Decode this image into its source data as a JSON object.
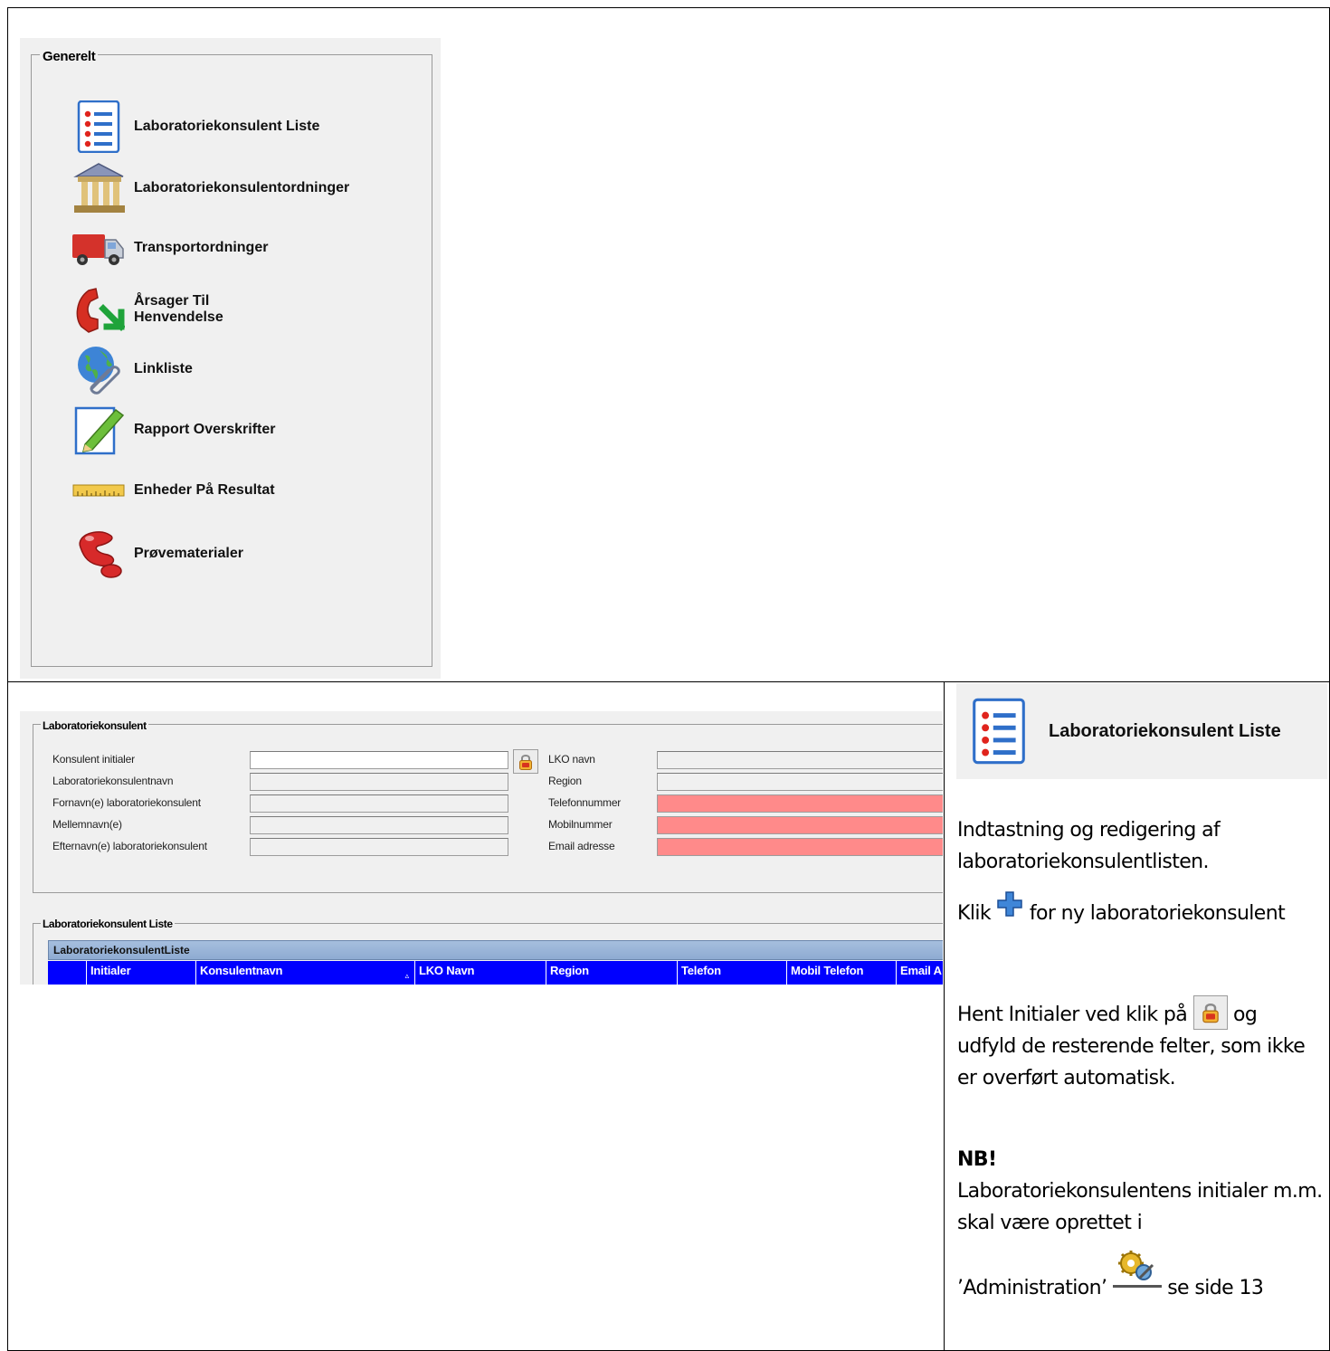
{
  "generelt": {
    "title": "Generelt",
    "items": [
      {
        "label": "Laboratoriekonsulent Liste",
        "icon": "list-icon"
      },
      {
        "label": "Laboratoriekonsulentordninger",
        "icon": "building-icon"
      },
      {
        "label": "Transportordninger",
        "icon": "truck-icon"
      },
      {
        "label": "Årsager Til\nHenvendelse",
        "icon": "phone-icon"
      },
      {
        "label": "Linkliste",
        "icon": "globe-link-icon"
      },
      {
        "label": "Rapport Overskrifter",
        "icon": "edit-pencil-icon"
      },
      {
        "label": "Enheder På Resultat",
        "icon": "ruler-icon"
      },
      {
        "label": "Prøvematerialer",
        "icon": "sample-blob-icon"
      }
    ]
  },
  "form": {
    "title": "Laboratoriekonsulent",
    "fields_left": [
      {
        "label": "Konsulent initialer",
        "value": ""
      },
      {
        "label": "Laboratoriekonsulentnavn",
        "value": ""
      },
      {
        "label": "Fornavn(e) laboratoriekonsulent",
        "value": ""
      },
      {
        "label": "Mellemnavn(e)",
        "value": ""
      },
      {
        "label": "Efternavn(e) laboratoriekonsulent",
        "value": ""
      }
    ],
    "fields_right": [
      {
        "label": "LKO navn",
        "value": ""
      },
      {
        "label": "Region",
        "value": ""
      },
      {
        "label": "Telefonnummer",
        "value": ""
      },
      {
        "label": "Mobilnummer",
        "value": ""
      },
      {
        "label": "Email adresse",
        "value": ""
      }
    ],
    "required_color": "#ff8a8a"
  },
  "list": {
    "title": "Laboratoriekonsulent Liste",
    "grid_caption": "LaboratoriekonsulentListe",
    "columns": [
      "Initialer",
      "Konsulentnavn",
      "LKO Navn",
      "Region",
      "Telefon",
      "Mobil Telefon",
      "Email A"
    ],
    "header_color": "#0000ff"
  },
  "sidebar": {
    "ribbon_label": "Laboratoriekonsulent Liste",
    "p1": "Indtastning og redigering af laboratoriekonsulentlisten.",
    "klik": "Klik",
    "klik_rest": "for ny laboratoriekonsulent",
    "hent": "Hent Initialer ved klik på",
    "hent_rest": "og udfyld de resterende felter, som ikke er overført automatisk.",
    "nb": "NB!",
    "nb_text": "Laboratoriekonsulentens initialer m.m. skal være oprettet i",
    "admin": "’Administration’",
    "admin_rest": "se side 13"
  }
}
